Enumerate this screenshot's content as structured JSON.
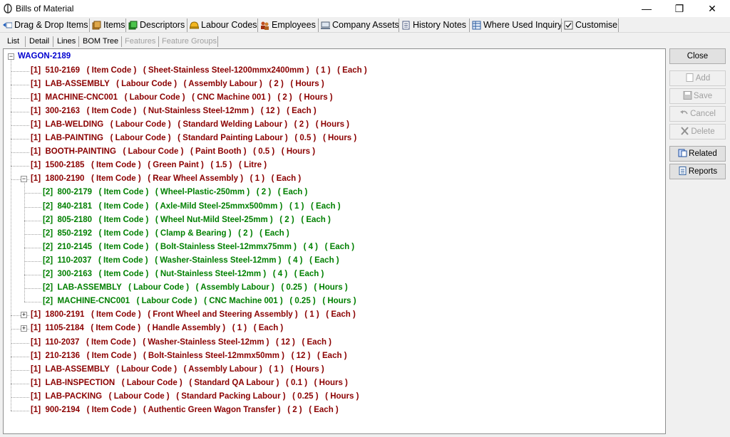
{
  "window": {
    "title": "Bills of Material",
    "controls": {
      "minimize": "—",
      "maximize": "❐",
      "close": "✕"
    }
  },
  "toolbar": {
    "items": [
      {
        "label": "Drag & Drop Items",
        "icon": "drag-drop-icon"
      },
      {
        "label": "Items",
        "icon": "items-icon"
      },
      {
        "label": "Descriptors",
        "icon": "descriptors-icon"
      },
      {
        "label": "Labour Codes",
        "icon": "labour-codes-icon"
      },
      {
        "label": "Employees",
        "icon": "employees-icon"
      },
      {
        "label": "Company Assets",
        "icon": "company-assets-icon"
      },
      {
        "label": "History Notes",
        "icon": "history-notes-icon"
      },
      {
        "label": "Where Used Inquiry",
        "icon": "where-used-icon"
      },
      {
        "label": "Customise",
        "icon": "customise-checkbox-icon"
      }
    ]
  },
  "tabs": [
    {
      "label": "List",
      "enabled": true
    },
    {
      "label": "Detail",
      "enabled": true
    },
    {
      "label": "Lines",
      "enabled": true
    },
    {
      "label": "BOM Tree",
      "enabled": true,
      "active": true
    },
    {
      "label": "Features",
      "enabled": false
    },
    {
      "label": "Feature Groups",
      "enabled": false
    }
  ],
  "tree": {
    "root": "WAGON-2189",
    "rows": [
      {
        "level": 1,
        "text": "[1]  510-2169   ( Item Code )   ( Sheet-Stainless Steel-1200mmx2400mm )   ( 1 )   ( Each )"
      },
      {
        "level": 1,
        "text": "[1]  LAB-ASSEMBLY   ( Labour Code )   ( Assembly Labour )   ( 2 )   ( Hours )"
      },
      {
        "level": 1,
        "text": "[1]  MACHINE-CNC001   ( Labour Code )   ( CNC Machine 001 )   ( 2 )   ( Hours )"
      },
      {
        "level": 1,
        "text": "[1]  300-2163   ( Item Code )   ( Nut-Stainless Steel-12mm )   ( 12 )   ( Each )"
      },
      {
        "level": 1,
        "text": "[1]  LAB-WELDING   ( Labour Code )   ( Standard Welding Labour )   ( 2 )   ( Hours )"
      },
      {
        "level": 1,
        "text": "[1]  LAB-PAINTING   ( Labour Code )   ( Standard Painting Labour )   ( 0.5 )   ( Hours )"
      },
      {
        "level": 1,
        "text": "[1]  BOOTH-PAINTING   ( Labour Code )   ( Paint Booth )   ( 0.5 )   ( Hours )"
      },
      {
        "level": 1,
        "text": "[1]  1500-2185   ( Item Code )   ( Green Paint )   ( 1.5 )   ( Litre )"
      },
      {
        "level": 1,
        "text": "[1]  1800-2190   ( Item Code )   ( Rear Wheel Assembly )   ( 1 )   ( Each )",
        "expander": "−"
      },
      {
        "level": 2,
        "text": "[2]  800-2179   ( Item Code )   ( Wheel-Plastic-250mm )   ( 2 )   ( Each )"
      },
      {
        "level": 2,
        "text": "[2]  840-2181   ( Item Code )   ( Axle-Mild Steel-25mmx500mm )   ( 1 )   ( Each )"
      },
      {
        "level": 2,
        "text": "[2]  805-2180   ( Item Code )   ( Wheel Nut-Mild Steel-25mm )   ( 2 )   ( Each )"
      },
      {
        "level": 2,
        "text": "[2]  850-2192   ( Item Code )   ( Clamp & Bearing )   ( 2 )   ( Each )"
      },
      {
        "level": 2,
        "text": "[2]  210-2145   ( Item Code )   ( Bolt-Stainless Steel-12mmx75mm )   ( 4 )   ( Each )"
      },
      {
        "level": 2,
        "text": "[2]  110-2037   ( Item Code )   ( Washer-Stainless Steel-12mm )   ( 4 )   ( Each )"
      },
      {
        "level": 2,
        "text": "[2]  300-2163   ( Item Code )   ( Nut-Stainless Steel-12mm )   ( 4 )   ( Each )"
      },
      {
        "level": 2,
        "text": "[2]  LAB-ASSEMBLY   ( Labour Code )   ( Assembly Labour )   ( 0.25 )   ( Hours )"
      },
      {
        "level": 2,
        "text": "[2]  MACHINE-CNC001   ( Labour Code )   ( CNC Machine 001 )   ( 0.25 )   ( Hours )"
      },
      {
        "level": 1,
        "text": "[1]  1800-2191   ( Item Code )   ( Front Wheel and Steering Assembly )   ( 1 )   ( Each )",
        "expander": "+"
      },
      {
        "level": 1,
        "text": "[1]  1105-2184   ( Item Code )   ( Handle Assembly )   ( 1 )   ( Each )",
        "expander": "+"
      },
      {
        "level": 1,
        "text": "[1]  110-2037   ( Item Code )   ( Washer-Stainless Steel-12mm )   ( 12 )   ( Each )"
      },
      {
        "level": 1,
        "text": "[1]  210-2136   ( Item Code )   ( Bolt-Stainless Steel-12mmx50mm )   ( 12 )   ( Each )"
      },
      {
        "level": 1,
        "text": "[1]  LAB-ASSEMBLY   ( Labour Code )   ( Assembly Labour )   ( 1 )   ( Hours )"
      },
      {
        "level": 1,
        "text": "[1]  LAB-INSPECTION   ( Labour Code )   ( Standard QA Labour )   ( 0.1 )   ( Hours )"
      },
      {
        "level": 1,
        "text": "[1]  LAB-PACKING   ( Labour Code )   ( Standard Packing Labour )   ( 0.25 )   ( Hours )"
      },
      {
        "level": 1,
        "text": "[1]  900-2194   ( Item Code )   ( Authentic Green Wagon Transfer )   ( 2 )   ( Each )"
      }
    ]
  },
  "side_buttons": [
    {
      "label": "Close",
      "enabled": true,
      "icon": ""
    },
    {
      "label": "Add",
      "enabled": false,
      "icon": "add-document-icon"
    },
    {
      "label": "Save",
      "enabled": false,
      "icon": "save-disk-icon"
    },
    {
      "label": "Cancel",
      "enabled": false,
      "icon": "undo-icon"
    },
    {
      "label": "Delete",
      "enabled": false,
      "icon": "delete-x-icon"
    },
    {
      "label": "Related",
      "enabled": true,
      "icon": "related-icon"
    },
    {
      "label": "Reports",
      "enabled": true,
      "icon": "reports-icon"
    }
  ],
  "colors": {
    "root": "#0000d0",
    "level1": "#8b0000",
    "level2": "#008000"
  }
}
